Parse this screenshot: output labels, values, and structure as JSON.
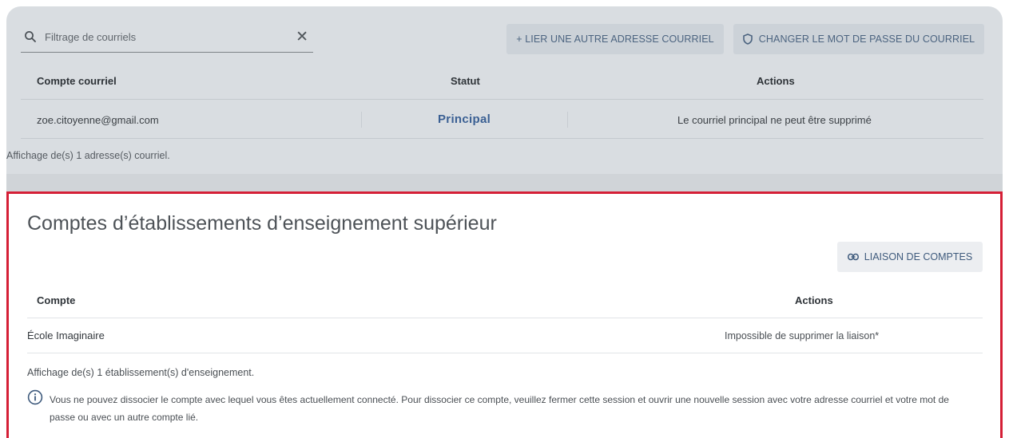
{
  "email_section": {
    "search": {
      "placeholder": "Filtrage de courriels",
      "clear_icon": "close-icon"
    },
    "buttons": {
      "link_email": "+ LIER UNE AUTRE ADRESSE COURRIEL",
      "change_password": "CHANGER LE MOT DE PASSE DU COURRIEL"
    },
    "table": {
      "headers": [
        "Compte courriel",
        "Statut",
        "Actions"
      ],
      "rows": [
        {
          "email": "zoe.citoyenne@gmail.com",
          "status": "Principal",
          "action": "Le courriel principal ne peut être supprimé"
        }
      ]
    },
    "footer": "Affichage de(s) 1 adresse(s) courriel."
  },
  "institution_section": {
    "title": "Comptes d’établissements d’enseignement supérieur",
    "link_button": "LIAISON DE COMPTES",
    "table": {
      "headers": [
        "Compte",
        "Actions"
      ],
      "rows": [
        {
          "account": "École Imaginaire",
          "action": "Impossible de supprimer la liaison*"
        }
      ]
    },
    "footer": "Affichage de(s) 1 établissement(s) d'enseignement.",
    "info_line1": "Vous ne pouvez dissocier le compte avec lequel vous êtes actuellement connecté. Pour dissocier ce compte, veuillez fermer cette session et ouvrir une nouvelle  session avec votre adresse courriel et votre mot de",
    "info_line2": "passe ou avec un autre compte lié."
  },
  "colors": {
    "highlight_border": "#d51f36",
    "principal_text": "#3a5f93",
    "dim_overlay": "#d9dde1"
  }
}
